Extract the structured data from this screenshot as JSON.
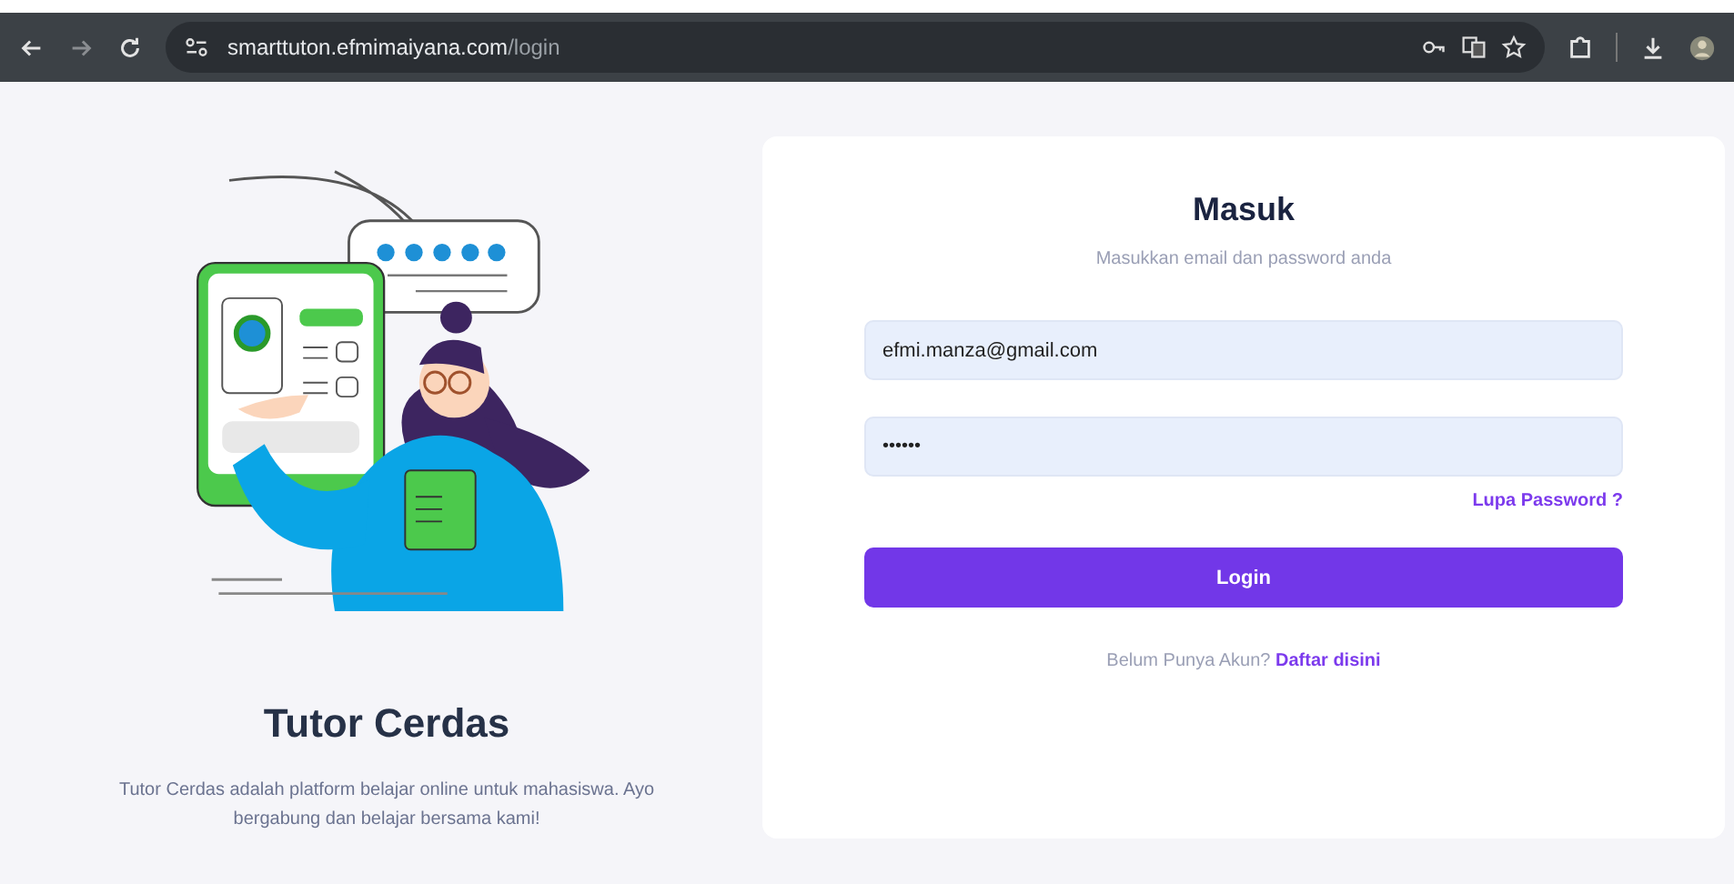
{
  "browser": {
    "url_host": "smarttuton.efmimaiyana.com",
    "url_path": "/login"
  },
  "intro": {
    "title": "Tutor Cerdas",
    "description": "Tutor Cerdas adalah platform belajar online untuk mahasiswa. Ayo bergabung dan belajar bersama kami!"
  },
  "login": {
    "title": "Masuk",
    "subtitle": "Masukkan email dan password anda",
    "email": {
      "value": "efmi.manza@gmail.com"
    },
    "password": {
      "value": "••••••"
    },
    "forgot_link": "Lupa Password ?",
    "submit": "Login",
    "register_prompt": "Belum Punya Akun?",
    "register_link": "Daftar disini"
  }
}
